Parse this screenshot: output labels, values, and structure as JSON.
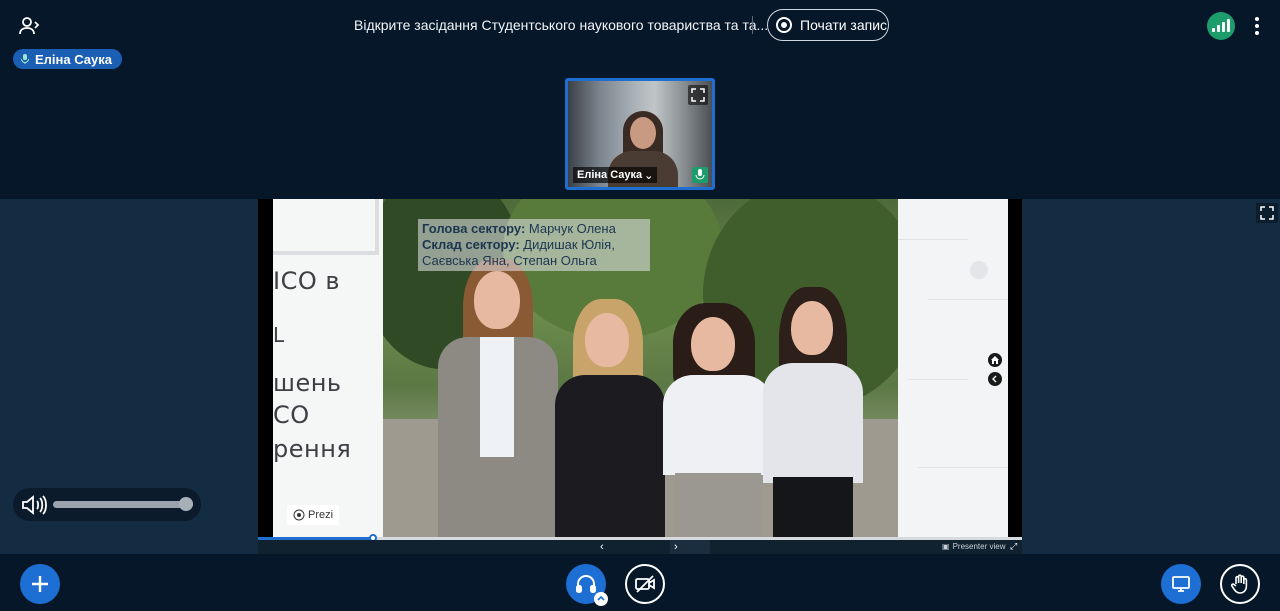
{
  "header": {
    "meeting_title": "Відкрите засідання Студентського наукового товариства та та...",
    "record_label": "Почати запис"
  },
  "talking_indicator": {
    "name": "Еліна Саука"
  },
  "webcam": {
    "user_name": "Еліна Саука"
  },
  "slide": {
    "left_lines": [
      "ICO в",
      "L",
      "шень",
      "CO",
      "рення"
    ],
    "caption_head_label": "Голова сектору:",
    "caption_head_value": " Марчук Олена",
    "caption_members_label": "Склад сектору:",
    "caption_members_value": " Дидишак Юлія, Саєвська Яна, Степан Ольга",
    "prezi_label": "Prezi",
    "presenter_view_label": "Presenter view",
    "progress_fraction": 0.15
  },
  "audio": {
    "volume_fraction": 0.95
  },
  "colors": {
    "accent": "#1d6fd3",
    "background": "#06172a",
    "stage": "#132c42",
    "connection": "#1d9d6c"
  }
}
